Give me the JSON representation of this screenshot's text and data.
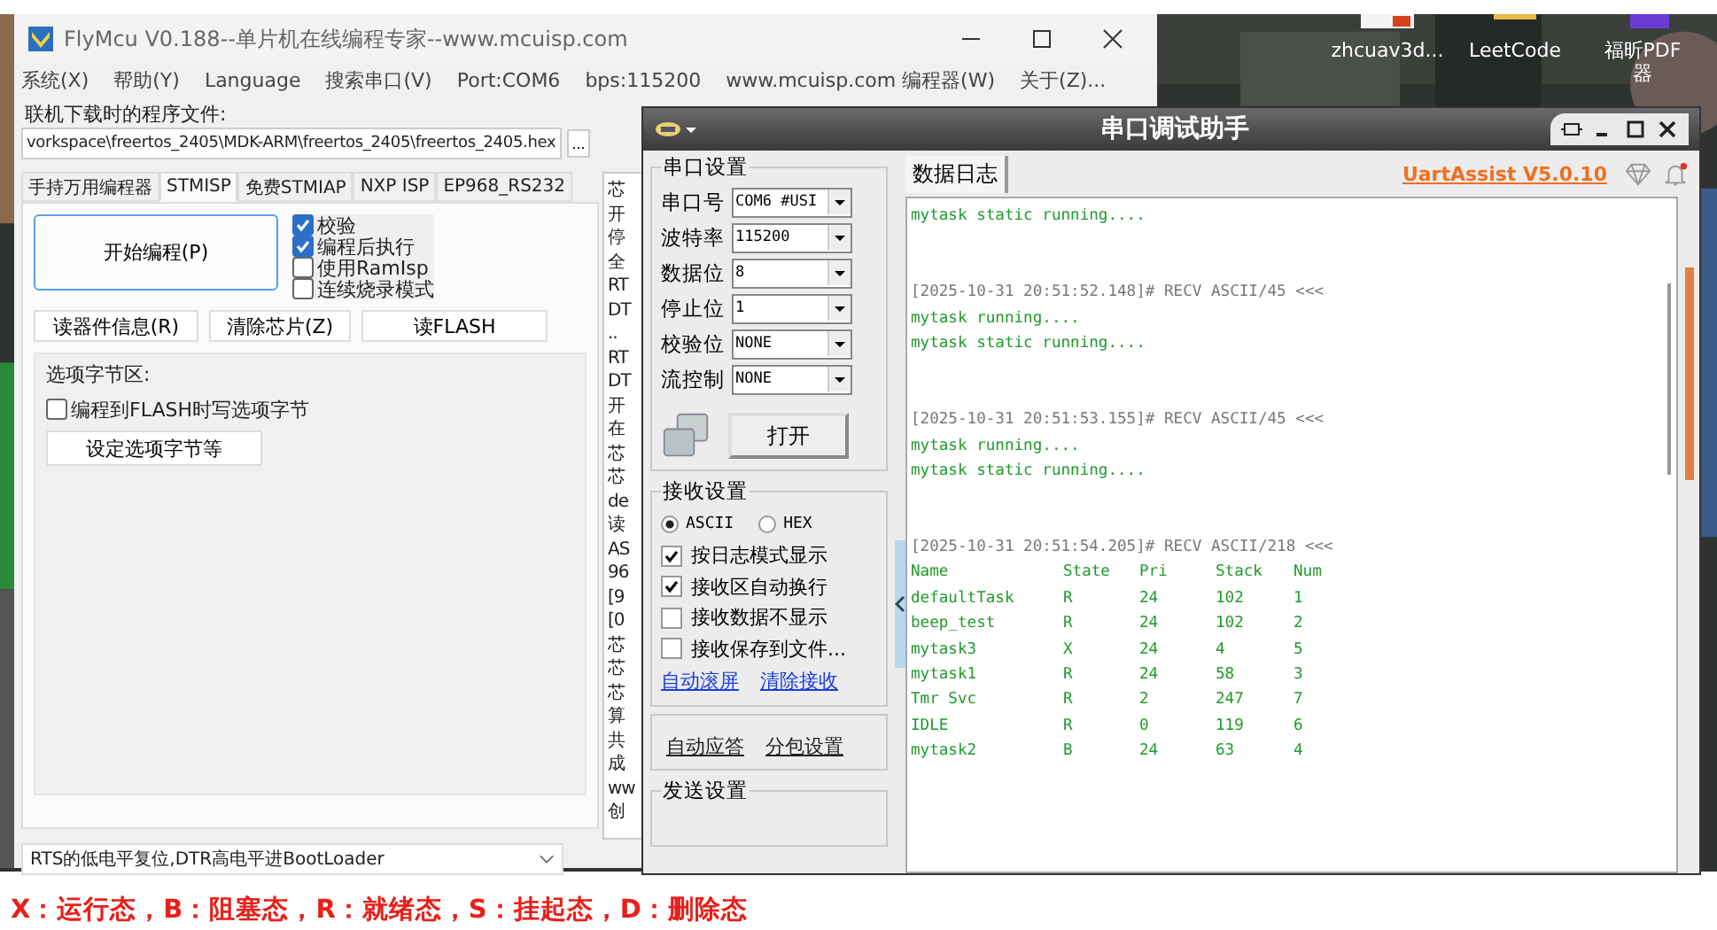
{
  "desktop": {
    "icons": [
      {
        "lines": [
          "zhcuav3d..."
        ]
      },
      {
        "lines": [
          "LeetCode"
        ]
      },
      {
        "lines": [
          "福昕PDF",
          "器"
        ]
      }
    ]
  },
  "flymcu": {
    "title": "FlyMcu V0.188--单片机在线编程专家--www.mcuisp.com",
    "menu": [
      "系统(X)",
      "帮助(Y)",
      "Language",
      "搜索串口(V)",
      "Port:COM6",
      "bps:115200",
      "www.mcuisp.com 编程器(W)",
      "关于(Z)..."
    ],
    "file_label": "联机下载时的程序文件:",
    "file_path": "vorkspace\\freertos_2405\\MDK-ARM\\freertos_2405\\freertos_2405.hex",
    "browse_button": "...",
    "tabs": [
      {
        "label": "手持万用编程器",
        "selected": false
      },
      {
        "label": "STMISP",
        "selected": true
      },
      {
        "label": "免费STMIAP",
        "selected": false
      },
      {
        "label": "NXP ISP",
        "selected": false
      },
      {
        "label": "EP968_RS232",
        "selected": false
      }
    ],
    "program_button": "开始编程(P)",
    "options": [
      {
        "label": "校验",
        "checked": true
      },
      {
        "label": "编程后执行",
        "checked": true
      },
      {
        "label": "使用RamIsp",
        "checked": false
      },
      {
        "label": "连续烧录模式",
        "checked": false
      }
    ],
    "action_buttons": [
      "读器件信息(R)",
      "清除芯片(Z)",
      "读FLASH"
    ],
    "option_bytes": {
      "title": "选项字节区:",
      "checkbox": {
        "label": "编程到FLASH时写选项字节",
        "checked": false
      },
      "button": "设定选项字节等"
    },
    "log_fragments": [
      "芯",
      "开",
      "停",
      "全",
      "RT",
      "DT",
      "..",
      "RT",
      "DT",
      "开",
      "在",
      "芯",
      "芯",
      "de",
      "读",
      "AS",
      "96",
      "[9",
      "[0",
      "芯",
      "芯",
      "芯",
      "算",
      "共",
      "成",
      "ww",
      "创"
    ],
    "boot_mode": "RTS的低电平复位,DTR高电平进BootLoader"
  },
  "uart": {
    "title": "串口调试助手",
    "serial_settings": {
      "title": "串口设置",
      "fields": [
        {
          "label": "串口号",
          "value": "COM6 #USI"
        },
        {
          "label": "波特率",
          "value": "115200"
        },
        {
          "label": "数据位",
          "value": "8"
        },
        {
          "label": "停止位",
          "value": "1"
        },
        {
          "label": "校验位",
          "value": "NONE"
        },
        {
          "label": "流控制",
          "value": "NONE"
        }
      ],
      "open_button": "打开"
    },
    "receive_settings": {
      "title": "接收设置",
      "modes": [
        {
          "label": "ASCII",
          "selected": true
        },
        {
          "label": "HEX",
          "selected": false
        }
      ],
      "options": [
        {
          "label": "按日志模式显示",
          "checked": true
        },
        {
          "label": "接收区自动换行",
          "checked": true
        },
        {
          "label": "接收数据不显示",
          "checked": false
        },
        {
          "label": "接收保存到文件...",
          "checked": false
        }
      ],
      "links": [
        "自动滚屏",
        "清除接收"
      ]
    },
    "extra_links": [
      "自动应答",
      "分包设置"
    ],
    "send_settings": {
      "title": "发送设置"
    },
    "log_tab": "数据日志",
    "version": "UartAssist V5.0.10",
    "log": [
      {
        "kind": "data",
        "text": "mytask static running...."
      },
      {
        "kind": "gap"
      },
      {
        "kind": "gap"
      },
      {
        "kind": "header",
        "text": "[2025-10-31 20:51:52.148]# RECV ASCII/45 <<<"
      },
      {
        "kind": "data",
        "text": "mytask running...."
      },
      {
        "kind": "data",
        "text": "mytask static running...."
      },
      {
        "kind": "gap"
      },
      {
        "kind": "gap"
      },
      {
        "kind": "header",
        "text": "[2025-10-31 20:51:53.155]# RECV ASCII/45 <<<"
      },
      {
        "kind": "data",
        "text": "mytask running...."
      },
      {
        "kind": "data",
        "text": "mytask static running...."
      },
      {
        "kind": "gap"
      },
      {
        "kind": "gap"
      },
      {
        "kind": "header",
        "text": "[2025-10-31 20:51:54.205]# RECV ASCII/218 <<<"
      },
      {
        "kind": "row",
        "cells": [
          "Name",
          "State",
          "Pri",
          "Stack",
          "Num"
        ]
      },
      {
        "kind": "row",
        "cells": [
          "defaultTask",
          "R",
          "24",
          "102",
          "1"
        ]
      },
      {
        "kind": "row",
        "cells": [
          "beep_test",
          "R",
          "24",
          "102",
          "2"
        ]
      },
      {
        "kind": "row",
        "cells": [
          "mytask3",
          "X",
          "24",
          "4",
          "5"
        ]
      },
      {
        "kind": "row",
        "cells": [
          "mytask1",
          "R",
          "24",
          "58",
          "3"
        ]
      },
      {
        "kind": "row",
        "cells": [
          "Tmr Svc",
          "R",
          "2",
          "247",
          "7"
        ]
      },
      {
        "kind": "row",
        "cells": [
          "IDLE",
          "R",
          "0",
          "119",
          "6"
        ]
      },
      {
        "kind": "row",
        "cells": [
          "mytask2",
          "B",
          "24",
          "63",
          "4"
        ]
      }
    ]
  },
  "caption": "X：运行态，B：阻塞态，R：就绪态，S：挂起态，D：删除态"
}
